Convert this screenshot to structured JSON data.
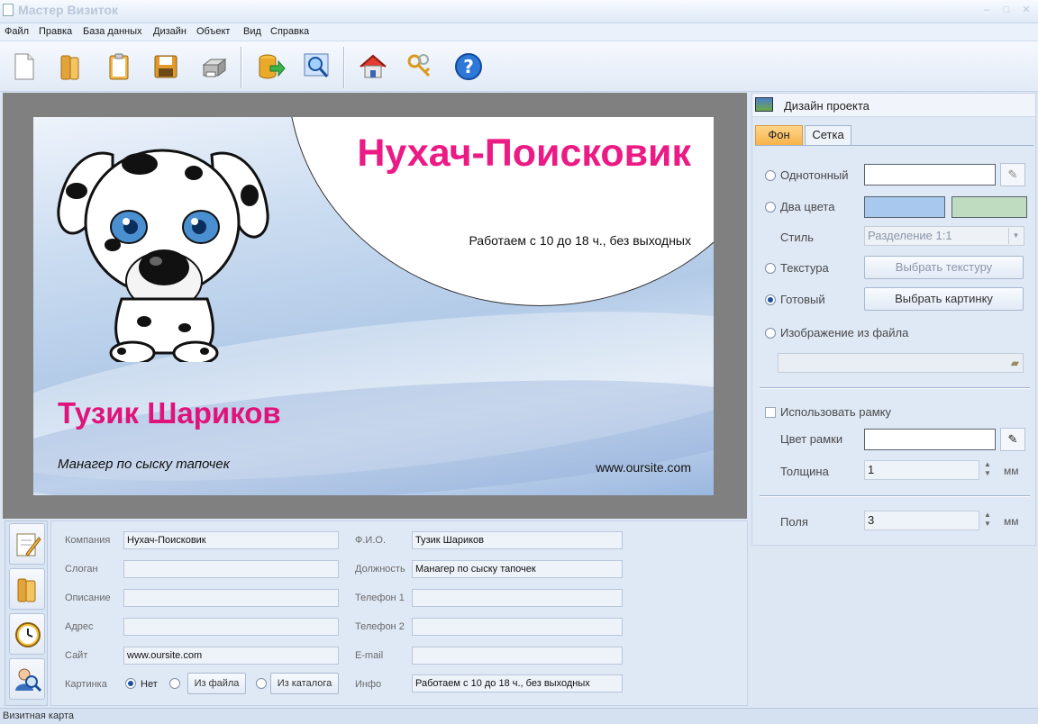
{
  "window": {
    "title": "Мастер Визиток"
  },
  "menu": [
    "Файл",
    "Правка",
    "База данных",
    "Дизайн",
    "Объект",
    "Вид",
    "Справка"
  ],
  "toolbar": {
    "buttons": [
      "new-document-icon",
      "open-folder-icon",
      "clipboard-icon",
      "save-icon",
      "print-icon",
      "database-export-icon",
      "zoom-preview-icon",
      "home-icon",
      "keys-icon",
      "help-icon"
    ]
  },
  "card": {
    "company": "Нухач-Поисковик",
    "hours": "Работаем с 10 до 18 ч., без выходных",
    "name": "Тузик Шариков",
    "position": "Манагер по сыску тапочек",
    "site": "www.oursite.com"
  },
  "panel": {
    "title": "Дизайн проекта",
    "tabs": [
      "Фон",
      "Сетка"
    ],
    "solid_label": "Однотонный",
    "two_colors_label": "Два цвета",
    "two_color_a": "#a9c8ee",
    "two_color_b": "#bfdcc0",
    "style_label": "Стиль",
    "style_value": "Разделение 1:1",
    "texture_label": "Текстура",
    "texture_button": "Выбрать текстуру",
    "ready_label": "Готовый",
    "ready_button": "Выбрать картинку",
    "file_label": "Изображение из файла",
    "use_frame_label": "Использовать рамку",
    "frame_color_label": "Цвет рамки",
    "thickness_label": "Толщина",
    "thickness_value": "1",
    "margins_label": "Поля",
    "margins_value": "3",
    "unit": "мм"
  },
  "form": {
    "company_label": "Компания",
    "company_value": "Нухач-Поисковик",
    "slogan_label": "Слоган",
    "slogan_value": "",
    "description_label": "Описание",
    "description_value": "",
    "address_label": "Адрес",
    "address_value": "",
    "site_label": "Сайт",
    "site_value": "www.oursite.com",
    "picture_label": "Картинка",
    "picture_none": "Нет",
    "picture_from_file": "Из файла",
    "picture_from_catalog": "Из каталога",
    "fio_label": "Ф.И.О.",
    "fio_value": "Тузик Шариков",
    "position_label": "Должность",
    "position_value": "Манагер по сыску тапочек",
    "phone1_label": "Телефон 1",
    "phone1_value": "",
    "phone2_label": "Телефон 2",
    "phone2_value": "",
    "email_label": "E-mail",
    "email_value": "",
    "info_label": "Инфо",
    "info_value": "Работаем с 10 до 18 ч., без выходных"
  },
  "status": {
    "text": "Визитная карта"
  }
}
